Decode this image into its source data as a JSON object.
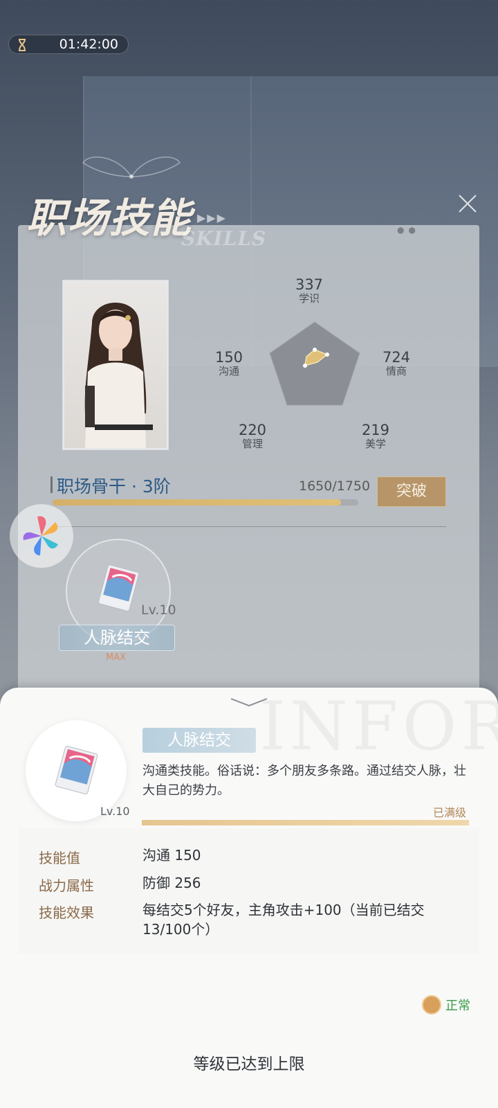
{
  "timer": {
    "value": "01:42:00",
    "icon": "hourglass-icon"
  },
  "header": {
    "title_zh": "职场技能",
    "title_en": "SKILLS"
  },
  "stats": {
    "xueshi": {
      "value": "337",
      "label": "学识"
    },
    "goutong": {
      "value": "150",
      "label": "沟通"
    },
    "qingshang": {
      "value": "724",
      "label": "情商"
    },
    "guanli": {
      "value": "220",
      "label": "管理"
    },
    "meixue": {
      "value": "219",
      "label": "美学"
    }
  },
  "rank": {
    "title": "职场骨干 · 3阶",
    "progress_text": "1650/1750",
    "progress_fraction": 0.943,
    "breakthrough_label": "突破"
  },
  "skill_card": {
    "level": "Lv.10",
    "name": "人脉结交",
    "max_label": "MAX"
  },
  "detail": {
    "watermark": "INFOR",
    "name": "人脉结交",
    "level": "Lv.10",
    "description": "沟通类技能。俗话说：多个朋友多条路。通过结交人脉，壮大自己的势力。",
    "maxed_label": "已满级",
    "attributes": [
      {
        "label": "技能值",
        "value": "沟通   150"
      },
      {
        "label": "战力属性",
        "value": "防御   256"
      },
      {
        "label": "技能效果",
        "value": "每结交5个好友，主角攻击+100（当前已结交13/100个）"
      }
    ],
    "status_text": "正常",
    "limit_message": "等级已达到上限"
  },
  "colors": {
    "gold": "#b79568",
    "blue_text": "#2d5a86",
    "green_status": "#3a9a48"
  }
}
